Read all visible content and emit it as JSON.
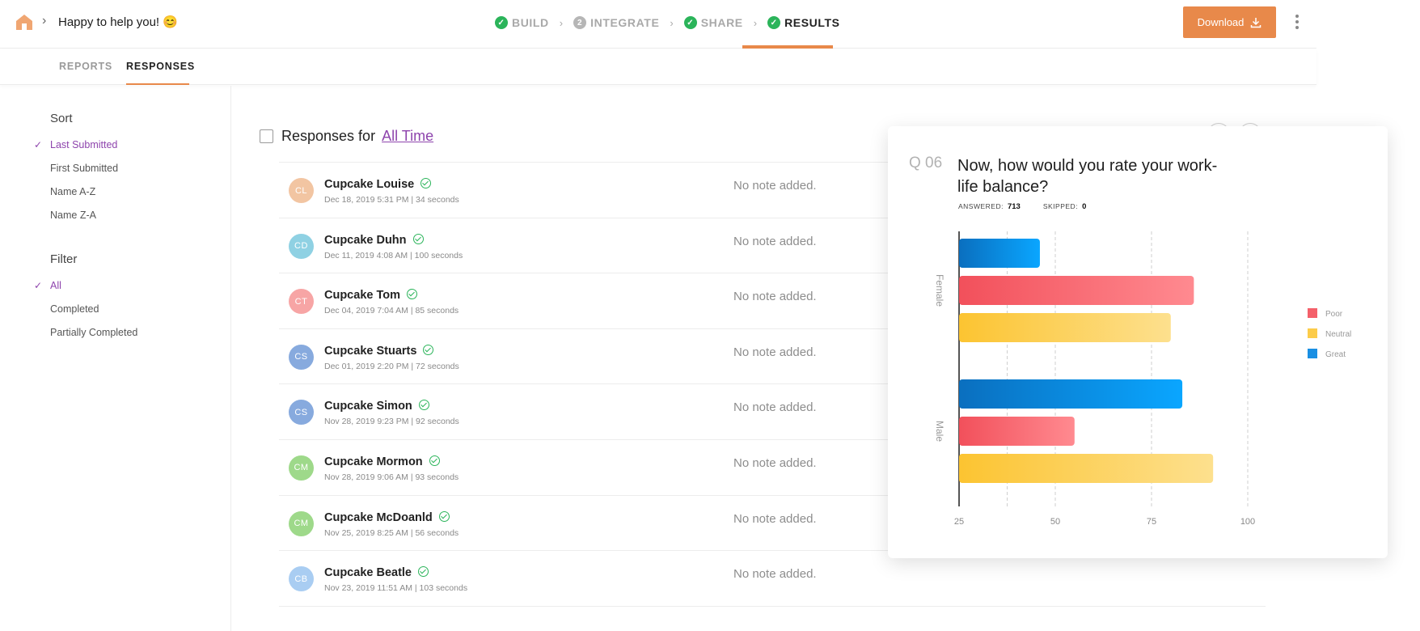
{
  "header": {
    "page_title": "Happy to help you! 😊",
    "steps": [
      {
        "label": "BUILD",
        "state": "done",
        "marker": ""
      },
      {
        "label": "INTEGRATE",
        "state": "pending",
        "marker": "2"
      },
      {
        "label": "SHARE",
        "state": "done",
        "marker": ""
      },
      {
        "label": "RESULTS",
        "state": "active",
        "marker": ""
      }
    ],
    "download_label": "Download",
    "accent": "#e8894a"
  },
  "tabs": [
    {
      "label": "REPORTS",
      "active": false
    },
    {
      "label": "RESPONSES",
      "active": true
    }
  ],
  "sidebar": {
    "sort_heading": "Sort",
    "sort_items": [
      {
        "label": "Last Submitted",
        "selected": true
      },
      {
        "label": "First Submitted",
        "selected": false
      },
      {
        "label": "Name A-Z",
        "selected": false
      },
      {
        "label": "Name Z-A",
        "selected": false
      }
    ],
    "filter_heading": "Filter",
    "filter_items": [
      {
        "label": "All",
        "selected": true
      },
      {
        "label": "Completed",
        "selected": false
      },
      {
        "label": "Partially Completed",
        "selected": false
      }
    ]
  },
  "responses": {
    "label": "Responses for",
    "range": "All Time",
    "rows": [
      {
        "initials": "CL",
        "color": "#f2c5a2",
        "name": "Cupcake Louise",
        "meta": "Dec 18, 2019 5:31 PM | 34 seconds",
        "note": "No note added."
      },
      {
        "initials": "CD",
        "color": "#8fd1e3",
        "name": "Cupcake Duhn",
        "meta": "Dec 11, 2019 4:08 AM | 100 seconds",
        "note": "No note added."
      },
      {
        "initials": "CT",
        "color": "#f7a5a5",
        "name": "Cupcake Tom",
        "meta": "Dec 04, 2019 7:04 AM | 85 seconds",
        "note": "No note added."
      },
      {
        "initials": "CS",
        "color": "#87aade",
        "name": "Cupcake Stuarts",
        "meta": "Dec 01, 2019 2:20 PM | 72 seconds",
        "note": "No note added."
      },
      {
        "initials": "CS",
        "color": "#87aade",
        "name": "Cupcake Simon",
        "meta": "Nov 28, 2019 9:23 PM | 92 seconds",
        "note": "No note added."
      },
      {
        "initials": "CM",
        "color": "#9ed98a",
        "name": "Cupcake Mormon",
        "meta": "Nov 28, 2019 9:06 AM | 93 seconds",
        "note": "No note added."
      },
      {
        "initials": "CM",
        "color": "#9ed98a",
        "name": "Cupcake McDoanld",
        "meta": "Nov 25, 2019 8:25 AM | 56 seconds",
        "note": "No note added."
      },
      {
        "initials": "CB",
        "color": "#a9cdf2",
        "name": "Cupcake Beatle",
        "meta": "Nov 23, 2019 11:51 AM | 103 seconds",
        "note": "No note added."
      }
    ]
  },
  "question": {
    "number": "Q 06",
    "text": "Now, how would you rate your work-life balance?",
    "answered_label": "ANSWERED:",
    "answered": "713",
    "skipped_label": "SKIPPED:",
    "skipped": "0"
  },
  "chart_data": {
    "type": "bar",
    "orientation": "horizontal",
    "categories": [
      "Female",
      "Male"
    ],
    "series": [
      {
        "name": "Great",
        "color": "#1a8fe3",
        "values": [
          46,
          83
        ]
      },
      {
        "name": "Poor",
        "color": "#f4606a",
        "values": [
          86,
          55
        ]
      },
      {
        "name": "Neutral",
        "color": "#fccc4a",
        "values": [
          80,
          91
        ]
      }
    ],
    "bar_order": [
      "Great",
      "Poor",
      "Neutral"
    ],
    "legend_order": [
      "Poor",
      "Neutral",
      "Great"
    ],
    "legend_position": "right",
    "xticks": [
      25,
      50,
      75,
      100
    ],
    "xlim": [
      25,
      100
    ],
    "grid": "dashed vertical"
  }
}
